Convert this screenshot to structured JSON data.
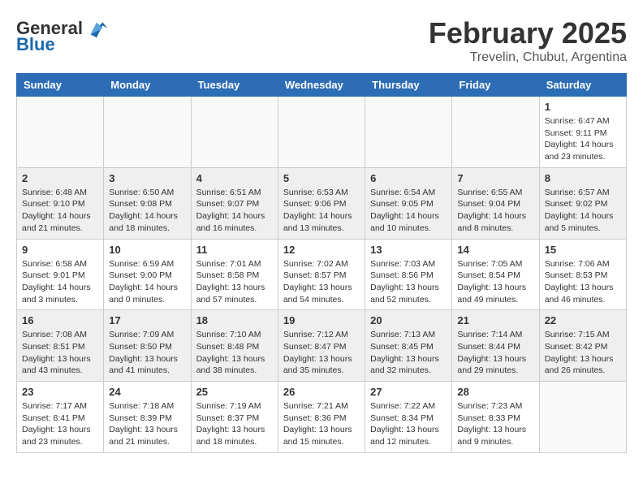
{
  "logo": {
    "text_general": "General",
    "text_blue": "Blue"
  },
  "header": {
    "month": "February 2025",
    "location": "Trevelin, Chubut, Argentina"
  },
  "weekdays": [
    "Sunday",
    "Monday",
    "Tuesday",
    "Wednesday",
    "Thursday",
    "Friday",
    "Saturday"
  ],
  "weeks": [
    [
      {
        "day": "",
        "info": ""
      },
      {
        "day": "",
        "info": ""
      },
      {
        "day": "",
        "info": ""
      },
      {
        "day": "",
        "info": ""
      },
      {
        "day": "",
        "info": ""
      },
      {
        "day": "",
        "info": ""
      },
      {
        "day": "1",
        "info": "Sunrise: 6:47 AM\nSunset: 9:11 PM\nDaylight: 14 hours\nand 23 minutes."
      }
    ],
    [
      {
        "day": "2",
        "info": "Sunrise: 6:48 AM\nSunset: 9:10 PM\nDaylight: 14 hours\nand 21 minutes."
      },
      {
        "day": "3",
        "info": "Sunrise: 6:50 AM\nSunset: 9:08 PM\nDaylight: 14 hours\nand 18 minutes."
      },
      {
        "day": "4",
        "info": "Sunrise: 6:51 AM\nSunset: 9:07 PM\nDaylight: 14 hours\nand 16 minutes."
      },
      {
        "day": "5",
        "info": "Sunrise: 6:53 AM\nSunset: 9:06 PM\nDaylight: 14 hours\nand 13 minutes."
      },
      {
        "day": "6",
        "info": "Sunrise: 6:54 AM\nSunset: 9:05 PM\nDaylight: 14 hours\nand 10 minutes."
      },
      {
        "day": "7",
        "info": "Sunrise: 6:55 AM\nSunset: 9:04 PM\nDaylight: 14 hours\nand 8 minutes."
      },
      {
        "day": "8",
        "info": "Sunrise: 6:57 AM\nSunset: 9:02 PM\nDaylight: 14 hours\nand 5 minutes."
      }
    ],
    [
      {
        "day": "9",
        "info": "Sunrise: 6:58 AM\nSunset: 9:01 PM\nDaylight: 14 hours\nand 3 minutes."
      },
      {
        "day": "10",
        "info": "Sunrise: 6:59 AM\nSunset: 9:00 PM\nDaylight: 14 hours\nand 0 minutes."
      },
      {
        "day": "11",
        "info": "Sunrise: 7:01 AM\nSunset: 8:58 PM\nDaylight: 13 hours\nand 57 minutes."
      },
      {
        "day": "12",
        "info": "Sunrise: 7:02 AM\nSunset: 8:57 PM\nDaylight: 13 hours\nand 54 minutes."
      },
      {
        "day": "13",
        "info": "Sunrise: 7:03 AM\nSunset: 8:56 PM\nDaylight: 13 hours\nand 52 minutes."
      },
      {
        "day": "14",
        "info": "Sunrise: 7:05 AM\nSunset: 8:54 PM\nDaylight: 13 hours\nand 49 minutes."
      },
      {
        "day": "15",
        "info": "Sunrise: 7:06 AM\nSunset: 8:53 PM\nDaylight: 13 hours\nand 46 minutes."
      }
    ],
    [
      {
        "day": "16",
        "info": "Sunrise: 7:08 AM\nSunset: 8:51 PM\nDaylight: 13 hours\nand 43 minutes."
      },
      {
        "day": "17",
        "info": "Sunrise: 7:09 AM\nSunset: 8:50 PM\nDaylight: 13 hours\nand 41 minutes."
      },
      {
        "day": "18",
        "info": "Sunrise: 7:10 AM\nSunset: 8:48 PM\nDaylight: 13 hours\nand 38 minutes."
      },
      {
        "day": "19",
        "info": "Sunrise: 7:12 AM\nSunset: 8:47 PM\nDaylight: 13 hours\nand 35 minutes."
      },
      {
        "day": "20",
        "info": "Sunrise: 7:13 AM\nSunset: 8:45 PM\nDaylight: 13 hours\nand 32 minutes."
      },
      {
        "day": "21",
        "info": "Sunrise: 7:14 AM\nSunset: 8:44 PM\nDaylight: 13 hours\nand 29 minutes."
      },
      {
        "day": "22",
        "info": "Sunrise: 7:15 AM\nSunset: 8:42 PM\nDaylight: 13 hours\nand 26 minutes."
      }
    ],
    [
      {
        "day": "23",
        "info": "Sunrise: 7:17 AM\nSunset: 8:41 PM\nDaylight: 13 hours\nand 23 minutes."
      },
      {
        "day": "24",
        "info": "Sunrise: 7:18 AM\nSunset: 8:39 PM\nDaylight: 13 hours\nand 21 minutes."
      },
      {
        "day": "25",
        "info": "Sunrise: 7:19 AM\nSunset: 8:37 PM\nDaylight: 13 hours\nand 18 minutes."
      },
      {
        "day": "26",
        "info": "Sunrise: 7:21 AM\nSunset: 8:36 PM\nDaylight: 13 hours\nand 15 minutes."
      },
      {
        "day": "27",
        "info": "Sunrise: 7:22 AM\nSunset: 8:34 PM\nDaylight: 13 hours\nand 12 minutes."
      },
      {
        "day": "28",
        "info": "Sunrise: 7:23 AM\nSunset: 8:33 PM\nDaylight: 13 hours\nand 9 minutes."
      },
      {
        "day": "",
        "info": ""
      }
    ]
  ]
}
